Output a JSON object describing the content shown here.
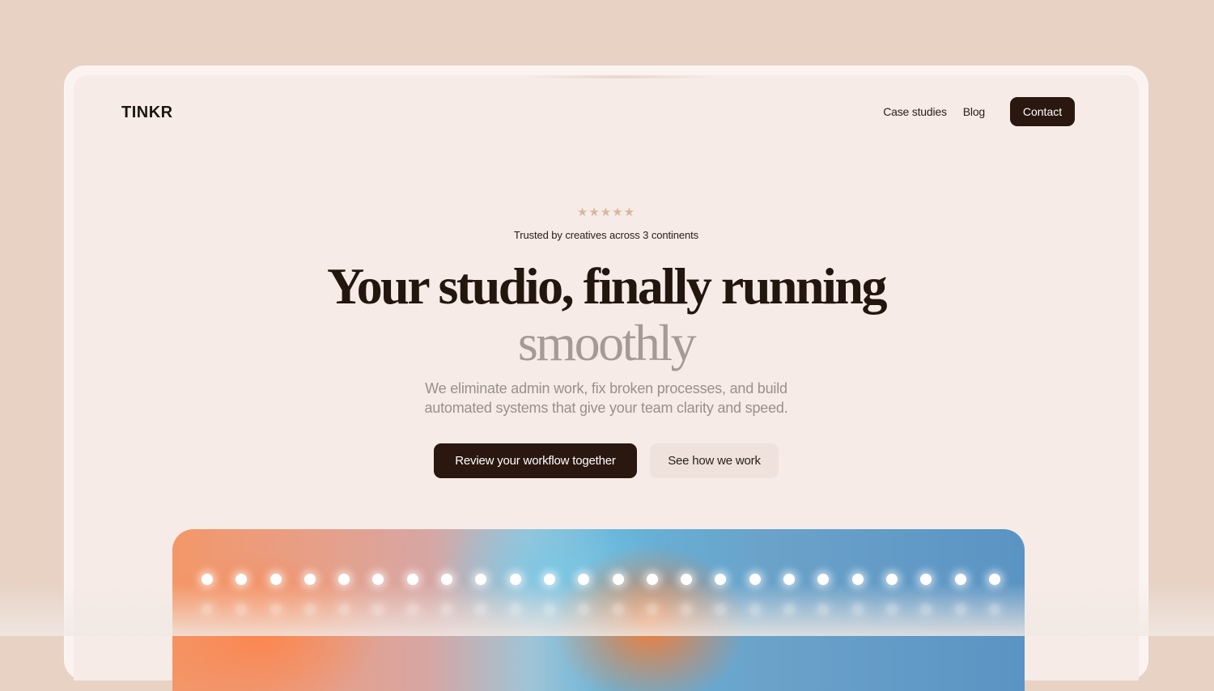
{
  "brand": {
    "logo": "TINKR"
  },
  "nav": {
    "links": [
      "Case studies",
      "Blog"
    ],
    "contact_label": "Contact"
  },
  "hero": {
    "stars": "★★★★★",
    "trusted_text": "Trusted by creatives across 3 continents",
    "headline": "Your studio, finally running",
    "headline_accent": "smoothly",
    "subtext_line1": "We eliminate admin work, fix broken processes, and build",
    "subtext_line2": "automated systems that give your team clarity and speed.",
    "primary_cta": "Review your workflow together",
    "secondary_cta": "See how we work"
  },
  "colors": {
    "background": "#e7d2c4",
    "panel": "#f6ebe6",
    "dark": "#2a1710",
    "accent_text": "#a59a94",
    "stars": "#d6b89d"
  }
}
